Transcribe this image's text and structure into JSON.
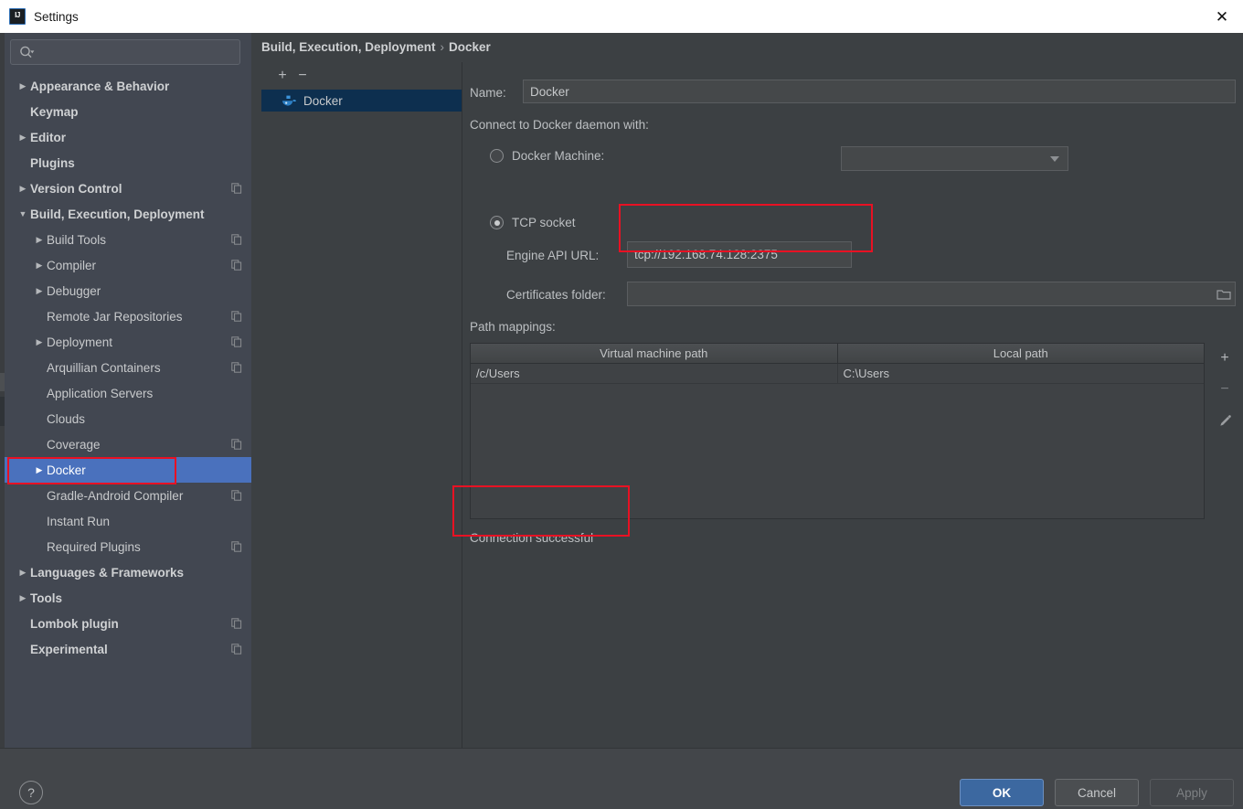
{
  "window": {
    "title": "Settings",
    "logo_icon": "intellij-idea-logo",
    "close_icon": "close-icon"
  },
  "search": {
    "value": "",
    "placeholder": "",
    "icon": "search-icon"
  },
  "sidebar": {
    "items": [
      {
        "label": "Appearance & Behavior",
        "level": 0,
        "twisty": "collapsed",
        "copy": false
      },
      {
        "label": "Keymap",
        "level": 0,
        "twisty": "none",
        "copy": false
      },
      {
        "label": "Editor",
        "level": 0,
        "twisty": "collapsed",
        "copy": false
      },
      {
        "label": "Plugins",
        "level": 0,
        "twisty": "none",
        "copy": false
      },
      {
        "label": "Version Control",
        "level": 0,
        "twisty": "collapsed",
        "copy": true
      },
      {
        "label": "Build, Execution, Deployment",
        "level": 0,
        "twisty": "expanded",
        "copy": false
      },
      {
        "label": "Build Tools",
        "level": 1,
        "twisty": "collapsed",
        "copy": true
      },
      {
        "label": "Compiler",
        "level": 1,
        "twisty": "collapsed",
        "copy": true
      },
      {
        "label": "Debugger",
        "level": 1,
        "twisty": "collapsed",
        "copy": false
      },
      {
        "label": "Remote Jar Repositories",
        "level": 1,
        "twisty": "none",
        "copy": true
      },
      {
        "label": "Deployment",
        "level": 1,
        "twisty": "collapsed",
        "copy": true
      },
      {
        "label": "Arquillian Containers",
        "level": 1,
        "twisty": "none",
        "copy": true
      },
      {
        "label": "Application Servers",
        "level": 1,
        "twisty": "none",
        "copy": false
      },
      {
        "label": "Clouds",
        "level": 1,
        "twisty": "none",
        "copy": false
      },
      {
        "label": "Coverage",
        "level": 1,
        "twisty": "none",
        "copy": true
      },
      {
        "label": "Docker",
        "level": 1,
        "twisty": "collapsed",
        "copy": false,
        "selected": true
      },
      {
        "label": "Gradle-Android Compiler",
        "level": 1,
        "twisty": "none",
        "copy": true
      },
      {
        "label": "Instant Run",
        "level": 1,
        "twisty": "none",
        "copy": false
      },
      {
        "label": "Required Plugins",
        "level": 1,
        "twisty": "none",
        "copy": true
      },
      {
        "label": "Languages & Frameworks",
        "level": 0,
        "twisty": "collapsed",
        "copy": false
      },
      {
        "label": "Tools",
        "level": 0,
        "twisty": "collapsed",
        "copy": false
      },
      {
        "label": "Lombok plugin",
        "level": 0,
        "twisty": "none",
        "copy": true
      },
      {
        "label": "Experimental",
        "level": 0,
        "twisty": "none",
        "copy": true
      }
    ]
  },
  "breadcrumb": {
    "parent": "Build, Execution, Deployment",
    "separator": "›",
    "current": "Docker"
  },
  "config_list": {
    "add_label": "+",
    "remove_label": "−",
    "items": [
      {
        "label": "Docker",
        "icon": "docker-whale-icon",
        "selected": true
      }
    ]
  },
  "form": {
    "name_label": "Name:",
    "name_value": "Docker",
    "connect_label": "Connect to Docker daemon with:",
    "docker_machine_label": "Docker Machine:",
    "docker_machine_value": "",
    "docker_machine_selected": false,
    "tcp_socket_label": "TCP socket",
    "tcp_socket_selected": true,
    "engine_api_label": "Engine API URL:",
    "engine_api_value": "tcp://192.168.74.128:2375",
    "certificates_label": "Certificates folder:",
    "certificates_value": "",
    "certificates_browse_icon": "folder-icon",
    "path_mappings_label": "Path mappings:",
    "connection_status": "Connection successful"
  },
  "table": {
    "columns": [
      "Virtual machine path",
      "Local path"
    ],
    "rows": [
      [
        "/c/Users",
        "C:\\Users"
      ]
    ],
    "toolbar": {
      "add": "+",
      "remove": "−",
      "edit_icon": "pencil-icon"
    }
  },
  "footer": {
    "help_label": "?",
    "ok_label": "OK",
    "cancel_label": "Cancel",
    "apply_label": "Apply"
  },
  "colors": {
    "accent_blue": "#4a71bd",
    "ok_button": "#3c68a0",
    "annotation_red": "#e81123",
    "sidebar_bg": "#424751",
    "panel_bg": "#3c4043",
    "list_selected": "#0d2f4f"
  }
}
